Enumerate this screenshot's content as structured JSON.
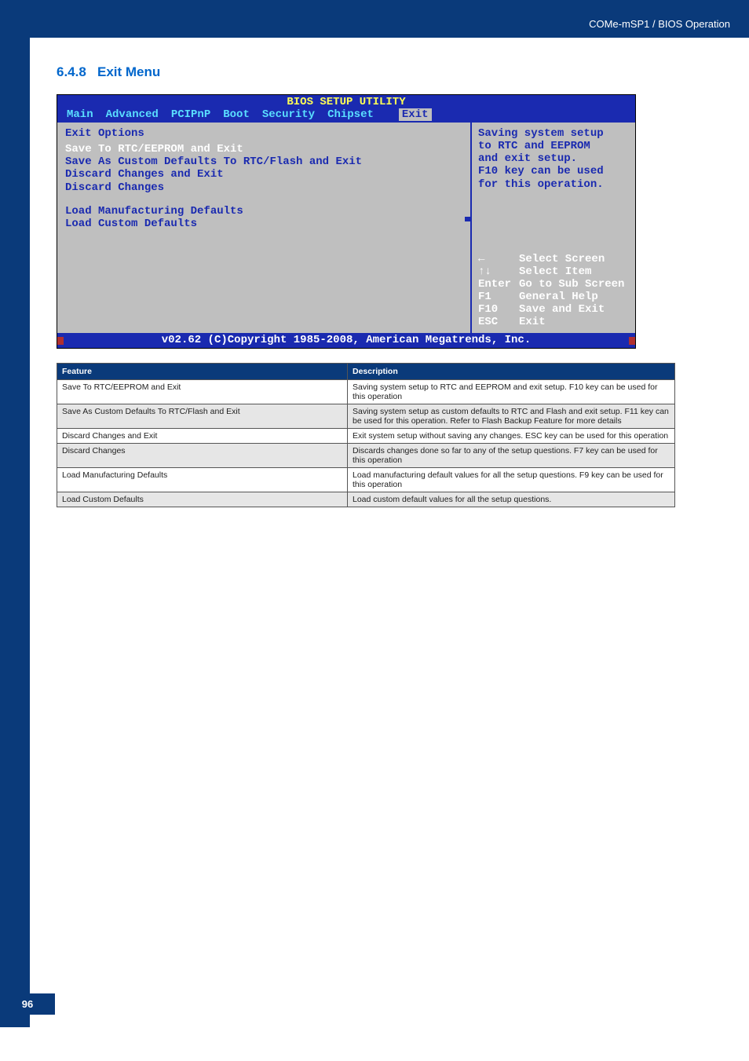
{
  "header": {
    "breadcrumb": "COMe-mSP1 / BIOS Operation"
  },
  "section": {
    "number": "6.4.8",
    "title": "Exit Menu"
  },
  "bios": {
    "title": "BIOS SETUP UTILITY",
    "tabs": [
      "Main",
      "Advanced",
      "PCIPnP",
      "Boot",
      "Security",
      "Chipset",
      "Exit"
    ],
    "active_tab": "Exit",
    "left": {
      "heading": "Exit Options",
      "items": [
        {
          "label": "Save To RTC/EEPROM and Exit",
          "selected": true
        },
        {
          "label": "Save As Custom Defaults To RTC/Flash and Exit",
          "selected": false
        },
        {
          "label": "Discard Changes and Exit",
          "selected": false
        },
        {
          "label": "Discard Changes",
          "selected": false
        }
      ],
      "items2": [
        {
          "label": "Load Manufacturing Defaults"
        },
        {
          "label": "Load Custom Defaults"
        }
      ]
    },
    "help": {
      "lines": [
        "Saving system setup",
        "to RTC and EEPROM",
        "and exit setup.",
        "",
        "F10 key can be used",
        "for this operation."
      ]
    },
    "keys": [
      {
        "key": "←",
        "action": "Select Screen"
      },
      {
        "key": "↑↓",
        "action": "Select Item"
      },
      {
        "key": "Enter",
        "action": "Go to Sub Screen"
      },
      {
        "key": "F1",
        "action": "General Help"
      },
      {
        "key": "F10",
        "action": "Save and Exit"
      },
      {
        "key": "ESC",
        "action": "Exit"
      }
    ],
    "footer": "v02.62 (C)Copyright 1985-2008, American Megatrends, Inc."
  },
  "table": {
    "headers": [
      "Feature",
      "Description"
    ],
    "rows": [
      [
        "Save To RTC/EEPROM and Exit",
        "Saving system setup to RTC and EEPROM and exit setup. F10 key can be used for this operation"
      ],
      [
        "Save As Custom Defaults To RTC/Flash and Exit",
        "Saving system setup as custom defaults to RTC and Flash and exit setup. F11 key can be used for this operation. Refer to Flash Backup Feature for more details"
      ],
      [
        "Discard Changes and Exit",
        "Exit system setup without saving any changes. ESC key can be used for this operation"
      ],
      [
        "Discard Changes",
        "Discards changes done so far to any of the setup questions. F7 key can be used for this operation"
      ],
      [
        "Load Manufacturing Defaults",
        "Load manufacturing default values for all the setup questions. F9 key can be used for this operation"
      ],
      [
        "Load Custom Defaults",
        "Load custom default values for all the setup questions."
      ]
    ]
  },
  "page_number": "96"
}
